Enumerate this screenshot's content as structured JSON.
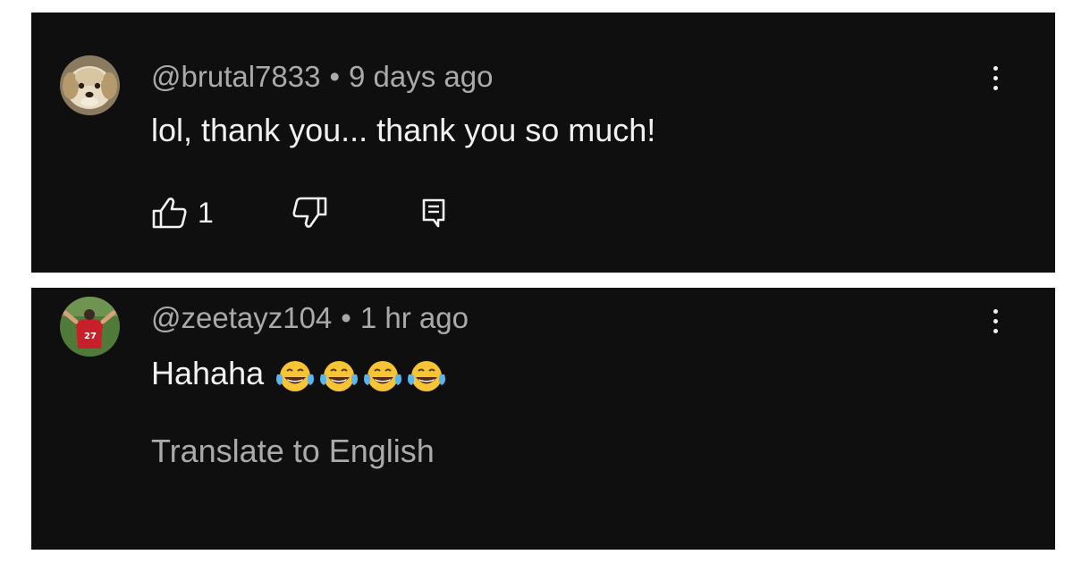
{
  "comments": [
    {
      "author": "@brutal7833",
      "separator": "•",
      "time": "9 days ago",
      "text": "lol, thank you... thank you so much!",
      "like_count": "1",
      "avatar": "puppy-avatar",
      "menu_icon": "more-vert-icon"
    },
    {
      "author": "@zeetayz104",
      "separator": "•",
      "time": "1 hr ago",
      "text": "Hahaha",
      "emojis": [
        "face-with-tears-of-joy",
        "face-with-tears-of-joy",
        "face-with-tears-of-joy",
        "face-with-tears-of-joy"
      ],
      "translate_label": "Translate to English",
      "avatar": "player-avatar",
      "menu_icon": "more-vert-icon"
    }
  ],
  "icons": {
    "like": "thumbs-up-icon",
    "dislike": "thumbs-down-icon",
    "reply": "reply-icon"
  },
  "colors": {
    "card_background": "#0f0f0f",
    "primary_text": "#f1f1f1",
    "secondary_text": "#aaaaaa",
    "page_background": "#ffffff"
  }
}
